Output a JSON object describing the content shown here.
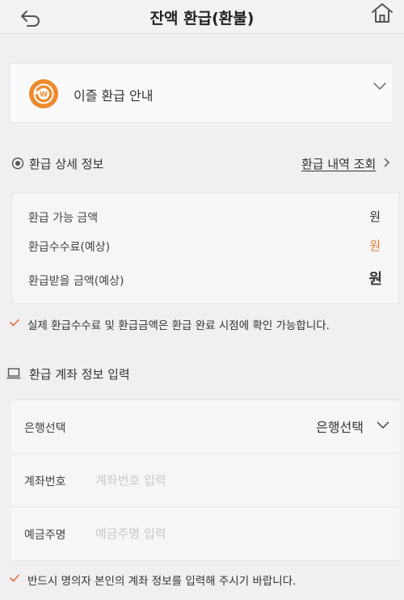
{
  "header": {
    "title": "잔액 환급(환불)",
    "back_icon": "back-arrow-icon",
    "home_icon": "home-icon"
  },
  "notice": {
    "label": "이즐 환급 안내",
    "icon": "coin-refund-icon",
    "accent": "#ee8a2e"
  },
  "refund_details": {
    "section_label": "환급 상세 정보",
    "history_link": "환급 내역 조회",
    "rows": [
      {
        "label": "환급 가능 금액",
        "value": "원"
      },
      {
        "label": "환급수수료(예상)",
        "value": "원"
      },
      {
        "label": "환급받을 금액(예상)",
        "value": "원"
      }
    ],
    "fee_color": "#e67a37"
  },
  "notes": {
    "fee_note": "실제 환급수수료 및 환급금액은 환급 완료 시점에 확인 가능합니다.",
    "account_note": "반드시 명의자 본인의 계좌 정보를 입력해 주시기 바랍니다.",
    "check_color": "#e0703a"
  },
  "account": {
    "section_label": "환급 계좌 정보 입력",
    "bank_label": "은행선택",
    "bank_value": "은행선택",
    "account_label": "계좌번호",
    "account_placeholder": "계좌번호 입력",
    "holder_label": "예금주명",
    "holder_placeholder": "예금주명 입력"
  }
}
